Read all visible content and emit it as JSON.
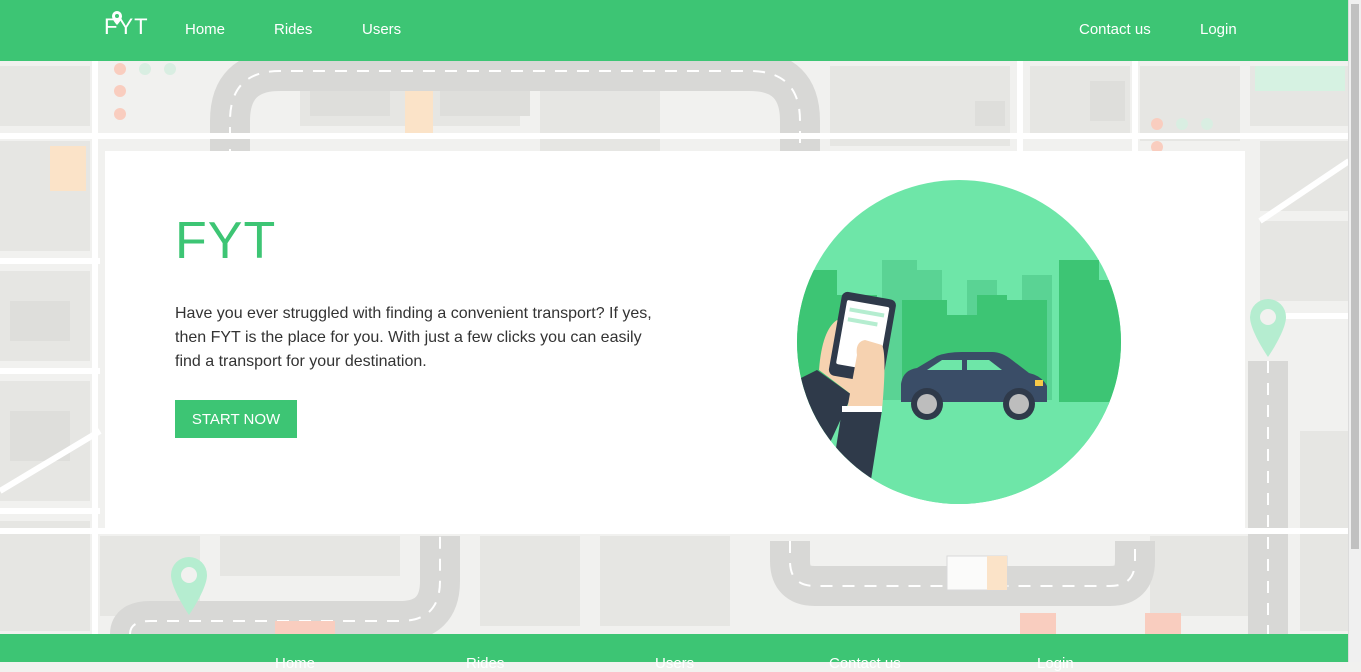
{
  "nav": {
    "brand": "FYT",
    "links": [
      "Home",
      "Rides",
      "Users"
    ],
    "right_links": [
      "Contact us",
      "Login"
    ]
  },
  "hero": {
    "title": "FYT",
    "text": "Have you ever struggled with finding a convenient transport? If yes, then FYT is the place for you. With just a few clicks you can easily find a transport for your destination.",
    "cta": "START NOW"
  },
  "footer": {
    "links": [
      "Home",
      "Rides",
      "Users",
      "Contact us",
      "Login"
    ]
  },
  "colors": {
    "brand_green": "#3dc574",
    "light_green": "#6ee6a8",
    "pin_green": "#b5edd0",
    "car_blue": "#3a4d67",
    "road_gray": "#d8d8d6",
    "map_bg": "#f1f1ef"
  },
  "icons": [
    "location-pin-icon",
    "car-illustration",
    "phone-illustration"
  ]
}
